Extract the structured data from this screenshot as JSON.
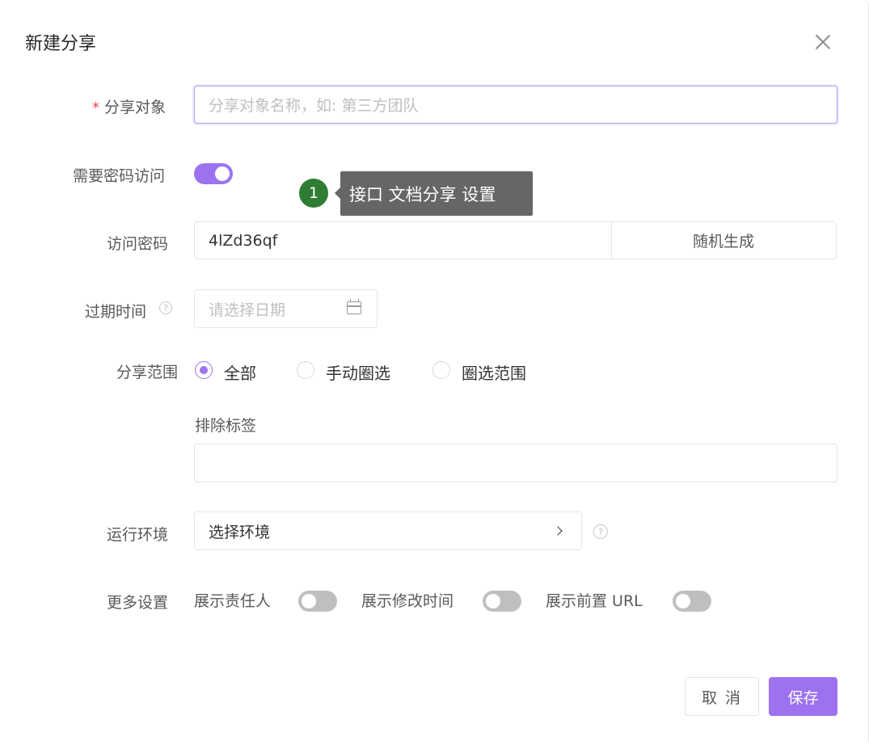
{
  "dialog": {
    "title": "新建分享"
  },
  "form": {
    "share_target": {
      "required_mark": "*",
      "label": "分享对象",
      "placeholder": "分享对象名称，如: 第三方团队"
    },
    "need_password": {
      "label": "需要密码访问",
      "enabled": true
    },
    "tooltip": {
      "badge": "1",
      "text": "接口 文档分享 设置"
    },
    "access_password": {
      "label": "访问密码",
      "value": "4lZd36qf",
      "generate_label": "随机生成"
    },
    "expire_time": {
      "label": "过期时间",
      "help": "?",
      "placeholder": "请选择日期"
    },
    "share_scope": {
      "label": "分享范围",
      "options": [
        {
          "label": "全部",
          "selected": true
        },
        {
          "label": "手动圈选",
          "selected": false
        },
        {
          "label": "圈选范围",
          "selected": false
        }
      ]
    },
    "exclude_tags": {
      "label": "排除标签",
      "value": ""
    },
    "run_env": {
      "label": "运行环境",
      "value": "选择环境",
      "help": "?"
    },
    "more_settings": {
      "label": "更多设置",
      "toggles": [
        {
          "label": "展示责任人",
          "enabled": false
        },
        {
          "label": "展示修改时间",
          "enabled": false
        },
        {
          "label": "展示前置 URL",
          "enabled": false
        }
      ]
    }
  },
  "footer": {
    "cancel_label": "取 消",
    "save_label": "保存"
  },
  "colors": {
    "accent": "#9c72f0",
    "badge": "#2e7d32",
    "tooltip_bg": "#666666",
    "required": "#e5484d"
  }
}
